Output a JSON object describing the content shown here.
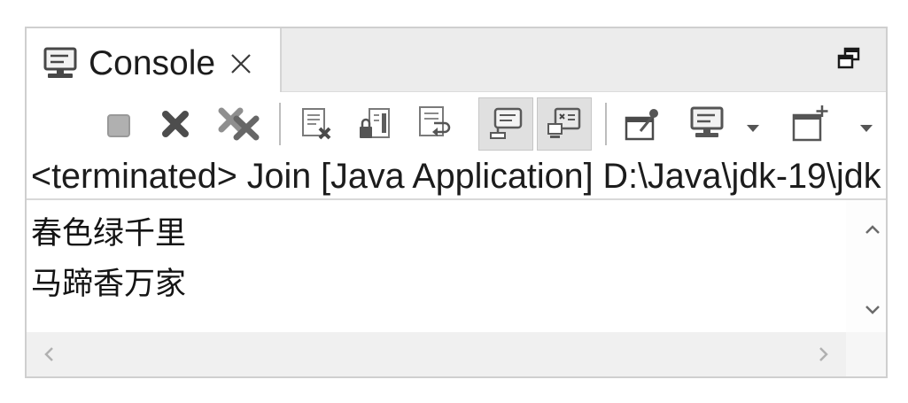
{
  "colors": {
    "panel_border": "#cfcfcf",
    "header_bg": "#ececec",
    "pressed_bg": "#e0e0e0",
    "scrollbar_bg": "#f0f0f0",
    "text": "#1c1c1c"
  },
  "view": {
    "tab": {
      "label": "Console",
      "icon": "console-icon",
      "close_icon": "close-icon"
    },
    "restore_icon": "restore-icon"
  },
  "toolbar": {
    "items": [
      {
        "icon": "terminate-icon",
        "enabled": false
      },
      {
        "icon": "remove-launch-icon"
      },
      {
        "icon": "remove-all-terminated-icon"
      },
      {
        "icon": "clear-console-icon"
      },
      {
        "icon": "scroll-lock-icon"
      },
      {
        "icon": "word-wrap-icon"
      },
      {
        "icon": "show-on-stdout-icon",
        "pressed": true
      },
      {
        "icon": "show-on-stderr-icon",
        "pressed": true
      },
      {
        "icon": "pin-console-icon"
      },
      {
        "icon": "display-selected-console-icon",
        "dropdown": true
      },
      {
        "icon": "open-console-icon",
        "dropdown": true
      }
    ]
  },
  "description": "<terminated> Join [Java Application] D:\\Java\\jdk-19\\jdk",
  "console": {
    "lines": [
      "春色绿千里",
      "马蹄香万家"
    ]
  },
  "scrollbars": {
    "vertical": {
      "up_icon": "chevron-up-icon",
      "down_icon": "chevron-down-icon"
    },
    "horizontal": {
      "left_icon": "chevron-left-icon",
      "right_icon": "chevron-right-icon"
    }
  }
}
